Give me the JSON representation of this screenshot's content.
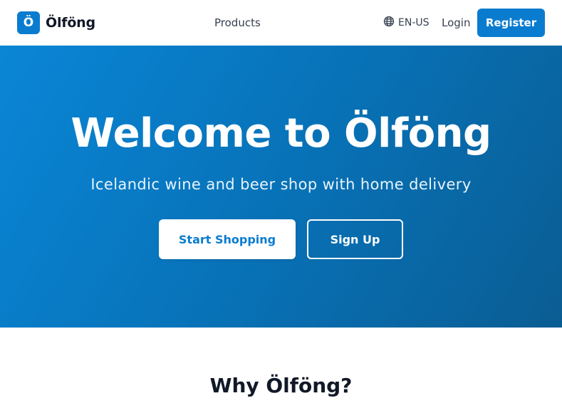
{
  "header": {
    "logo_mark": "Ö",
    "brand": "Ölföng",
    "nav": {
      "products": "Products"
    },
    "language": {
      "label": "EN-US",
      "icon": "globe-icon"
    },
    "login": "Login",
    "register": "Register"
  },
  "hero": {
    "title": "Welcome to Ölföng",
    "subtitle": "Icelandic wine and beer shop with home delivery",
    "primary_button": "Start Shopping",
    "secondary_button": "Sign Up"
  },
  "section": {
    "title": "Why Ölföng?"
  },
  "colors": {
    "accent": "#0a7ccf",
    "hero_gradient_start": "#0a86d6",
    "hero_gradient_end": "#0a5d93"
  }
}
